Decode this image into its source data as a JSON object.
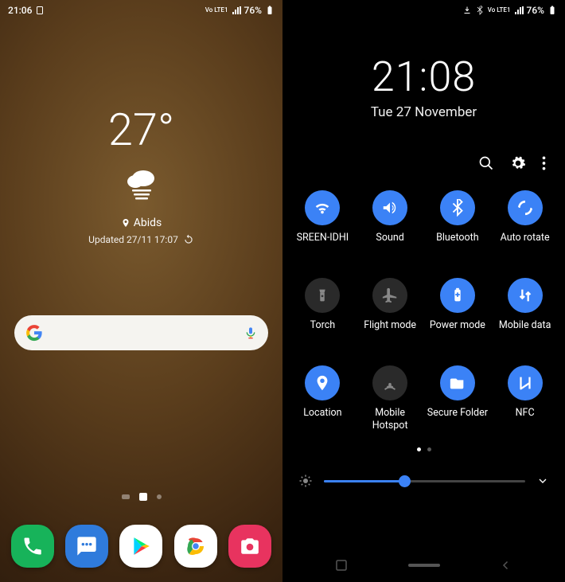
{
  "left": {
    "status": {
      "time": "21:06",
      "net_label": "Vo LTE1",
      "battery": "76%"
    },
    "weather": {
      "temp": "27°",
      "location": "Abids",
      "updated": "Updated 27/11 17:07"
    },
    "dock": {
      "items": [
        {
          "name": "phone",
          "bg": "#17b35a"
        },
        {
          "name": "messages",
          "bg": "#2f7bdc"
        },
        {
          "name": "play-store",
          "bg": "#ffffff"
        },
        {
          "name": "chrome",
          "bg": "#ffffff"
        },
        {
          "name": "camera",
          "bg": "#e8335f"
        }
      ]
    }
  },
  "right": {
    "status": {
      "net_label": "Vo LTE1",
      "battery": "76%"
    },
    "clock": {
      "time": "21:08",
      "date": "Tue 27 November"
    },
    "tiles": [
      {
        "label": "SREEN-IDHI",
        "icon": "wifi",
        "active": true
      },
      {
        "label": "Sound",
        "icon": "sound",
        "active": true
      },
      {
        "label": "Bluetooth",
        "icon": "bluetooth",
        "active": true
      },
      {
        "label": "Auto rotate",
        "icon": "rotate",
        "active": true
      },
      {
        "label": "Torch",
        "icon": "torch",
        "active": false
      },
      {
        "label": "Flight mode",
        "icon": "airplane",
        "active": false
      },
      {
        "label": "Power mode",
        "icon": "power",
        "active": true
      },
      {
        "label": "Mobile data",
        "icon": "data",
        "active": true
      },
      {
        "label": "Location",
        "icon": "location",
        "active": true
      },
      {
        "label": "Mobile Hotspot",
        "icon": "hotspot",
        "active": false
      },
      {
        "label": "Secure Folder",
        "icon": "folder",
        "active": true
      },
      {
        "label": "NFC",
        "icon": "nfc",
        "active": true
      }
    ],
    "brightness": {
      "percent": 40
    }
  }
}
